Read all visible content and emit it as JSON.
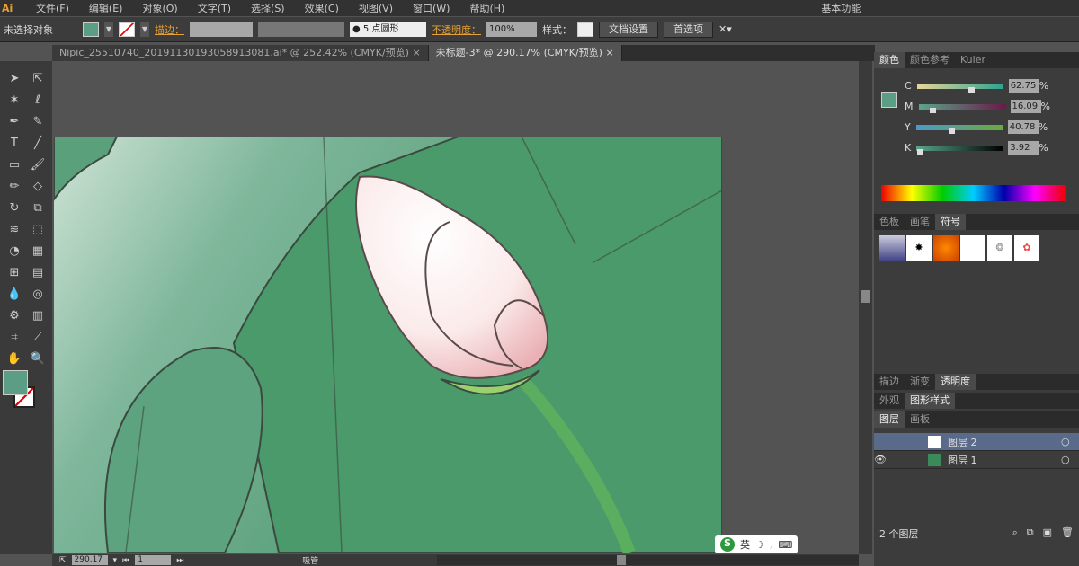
{
  "menubar": {
    "logo": "Ai",
    "items": [
      "文件(F)",
      "编辑(E)",
      "对象(O)",
      "文字(T)",
      "选择(S)",
      "效果(C)",
      "视图(V)",
      "窗口(W)",
      "帮助(H)"
    ],
    "workspace": "基本功能"
  },
  "control": {
    "selection": "未选择对象",
    "stroke_label": "描边：",
    "brush": "5 点圆形",
    "opacity_label": "不透明度：",
    "opacity": "100%",
    "style_label": "样式：",
    "doc_setup": "文档设置",
    "prefs": "首选项",
    "fill_color": "#5b9e85"
  },
  "tabs": [
    {
      "label": "Nipic_25510740_20191130193058913081.ai* @ 252.42% (CMYK/预览)"
    },
    {
      "label": "未标题-3* @ 290.17% (CMYK/预览)",
      "active": true
    }
  ],
  "color_panel": {
    "tabs": [
      "颜色",
      "颜色参考",
      "Kuler"
    ],
    "channels": [
      {
        "label": "C",
        "value": "62.75",
        "pct": 62.75
      },
      {
        "label": "M",
        "value": "16.09",
        "pct": 16.09
      },
      {
        "label": "Y",
        "value": "40.78",
        "pct": 40.78
      },
      {
        "label": "K",
        "value": "3.92",
        "pct": 3.92
      }
    ],
    "unit": "%"
  },
  "symbols_panel": {
    "tabs": [
      "色板",
      "画笔",
      "符号"
    ]
  },
  "stroke_tabs": [
    "描边",
    "渐变",
    "透明度"
  ],
  "appearance_tabs": [
    "外观",
    "图形样式"
  ],
  "layers_panel": {
    "tabs": [
      "图层",
      "画板"
    ],
    "layers": [
      {
        "name": "图层 2",
        "selected": true
      },
      {
        "name": "图层 1"
      }
    ],
    "count": "2 个图层"
  },
  "status": {
    "zoom": "290.17",
    "page": "1",
    "tool": "吸管"
  },
  "ime": {
    "label": "英"
  }
}
